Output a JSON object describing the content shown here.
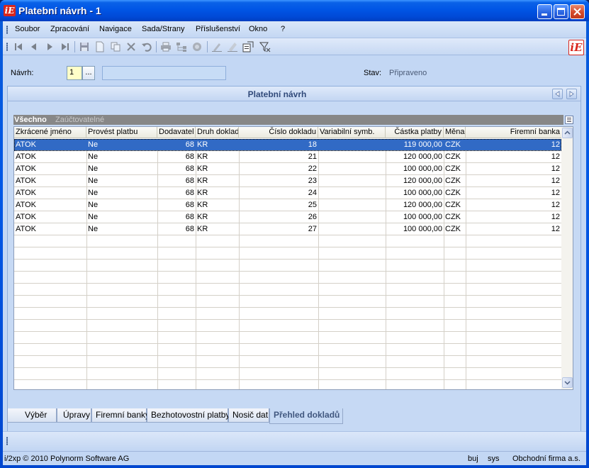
{
  "window": {
    "title": "Platební návrh - 1"
  },
  "menu": [
    "Soubor",
    "Zpracování",
    "Navigace",
    "Sada/Strany",
    "Příslušenství",
    "Okno",
    "?"
  ],
  "toolbar_icons": [
    "first-record-icon",
    "prev-record-icon",
    "next-record-icon",
    "last-record-icon",
    "save-icon",
    "new-document-icon",
    "copy-icon",
    "delete-icon",
    "undo-icon",
    "print-icon",
    "tree-icon",
    "refresh-icon",
    "edit-icon",
    "edit-all-icon",
    "export-icon",
    "filter-icon"
  ],
  "form": {
    "navrh_label": "Návrh:",
    "navrh_value": "1",
    "ellipsis": "...",
    "stav_label": "Stav:",
    "stav_value": "Připraveno"
  },
  "panel": {
    "title": "Platební návrh"
  },
  "filter": {
    "active": "Všechno",
    "inactive": "Zaúčtovatelné"
  },
  "grid": {
    "columns": [
      "Zkrácené jméno",
      "Provést platbu",
      "Dodavatel",
      "Druh doklad",
      "Číslo dokladu",
      "Variabilní symb.",
      "Částka platby",
      "Měna",
      "Firemní banka"
    ],
    "rows": [
      [
        "ATOK",
        "Ne",
        "68",
        "KR",
        "18",
        "",
        "119 000,00",
        "CZK",
        "12"
      ],
      [
        "ATOK",
        "Ne",
        "68",
        "KR",
        "21",
        "",
        "120 000,00",
        "CZK",
        "12"
      ],
      [
        "ATOK",
        "Ne",
        "68",
        "KR",
        "22",
        "",
        "100 000,00",
        "CZK",
        "12"
      ],
      [
        "ATOK",
        "Ne",
        "68",
        "KR",
        "23",
        "",
        "120 000,00",
        "CZK",
        "12"
      ],
      [
        "ATOK",
        "Ne",
        "68",
        "KR",
        "24",
        "",
        "100 000,00",
        "CZK",
        "12"
      ],
      [
        "ATOK",
        "Ne",
        "68",
        "KR",
        "25",
        "",
        "120 000,00",
        "CZK",
        "12"
      ],
      [
        "ATOK",
        "Ne",
        "68",
        "KR",
        "26",
        "",
        "100 000,00",
        "CZK",
        "12"
      ],
      [
        "ATOK",
        "Ne",
        "68",
        "KR",
        "27",
        "",
        "100 000,00",
        "CZK",
        "12"
      ]
    ],
    "selected_row": 0
  },
  "tabs": [
    "Výběr",
    "Úpravy",
    "Firemní banky",
    "Bezhotovostní platby",
    "Nosič dat",
    "Přehled dokladů"
  ],
  "active_tab": 5,
  "status": {
    "copyright": "i/2xp © 2010 Polynorm Software AG",
    "user": "buj",
    "db": "sys",
    "company": "Obchodní firma a.s."
  },
  "colors": {
    "selection": "#316ac5",
    "titlebar": "#0055e5",
    "client": "#c3d7f4"
  }
}
